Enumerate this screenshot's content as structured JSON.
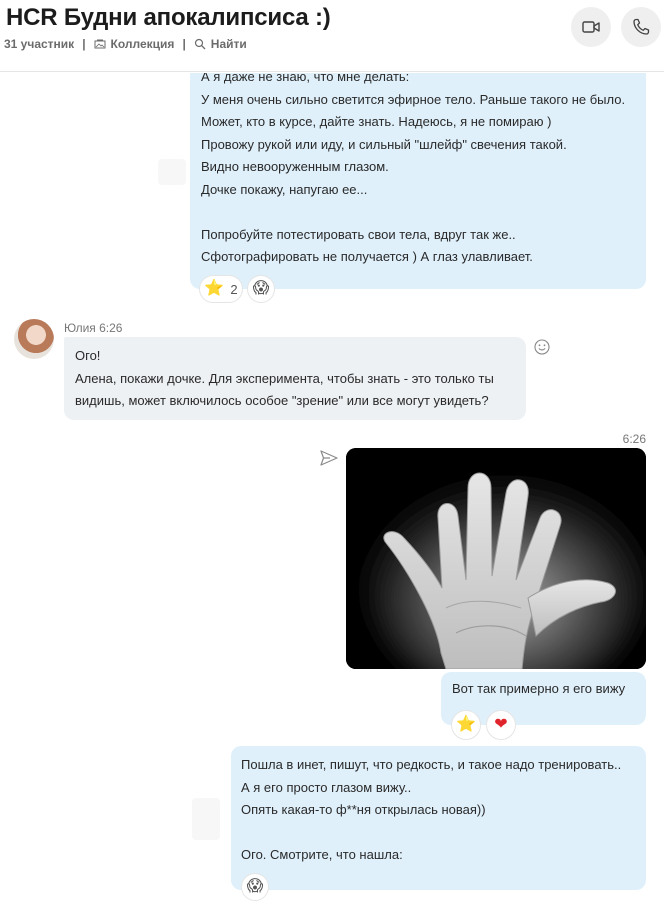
{
  "header": {
    "title": "HCR Будни апокалипсиса :)",
    "participants": "31 участник",
    "collection": "Коллекция",
    "search": "Найти"
  },
  "messages": {
    "first": {
      "lines": [
        "А я даже не знаю, что мне делать:",
        "У меня очень сильно светится эфирное тело. Раньше такого не было.",
        "Может, кто в курсе, дайте знать. Надеюсь, я не помираю )",
        "Провожу рукой или иду, и сильный \"шлейф\" свечения такой.",
        "Видно невооруженным глазом.",
        "Дочке покажу, напугаю ее...",
        "",
        "Попробуйте потестировать свои тела, вдруг так же..",
        "Сфотографировать не получается ) А глаз улавливает."
      ],
      "reactions": [
        {
          "emoji": "⭐",
          "count": "2"
        },
        {
          "emoji": "😱",
          "count": ""
        }
      ]
    },
    "julia": {
      "sender": "Юлия 6:26",
      "lines": [
        "Ого!",
        "Алена, покажи дочке. Для эксперимента, чтобы знать - это только ты",
        "видишь, может включилось особое \"зрение\" или все могут увидеть?"
      ]
    },
    "photo": {
      "time": "6:26"
    },
    "caption": {
      "text": "Вот так примерно я его вижу",
      "reactions": [
        {
          "emoji": "⭐"
        },
        {
          "emoji": "❤"
        }
      ]
    },
    "last": {
      "lines": [
        "Пошла в инет, пишут, что редкость, и такое надо тренировать..",
        "А я его просто глазом вижу..",
        "Опять какая-то ф**ня открылась новая))",
        "",
        "Ого. Смотрите, что нашла:"
      ],
      "reactions": [
        {
          "emoji": "😱"
        }
      ]
    }
  },
  "colors": {
    "outgoing_bubble": "#dff0fb",
    "incoming_bubble": "#eef1f4",
    "header_button": "#efefef"
  }
}
